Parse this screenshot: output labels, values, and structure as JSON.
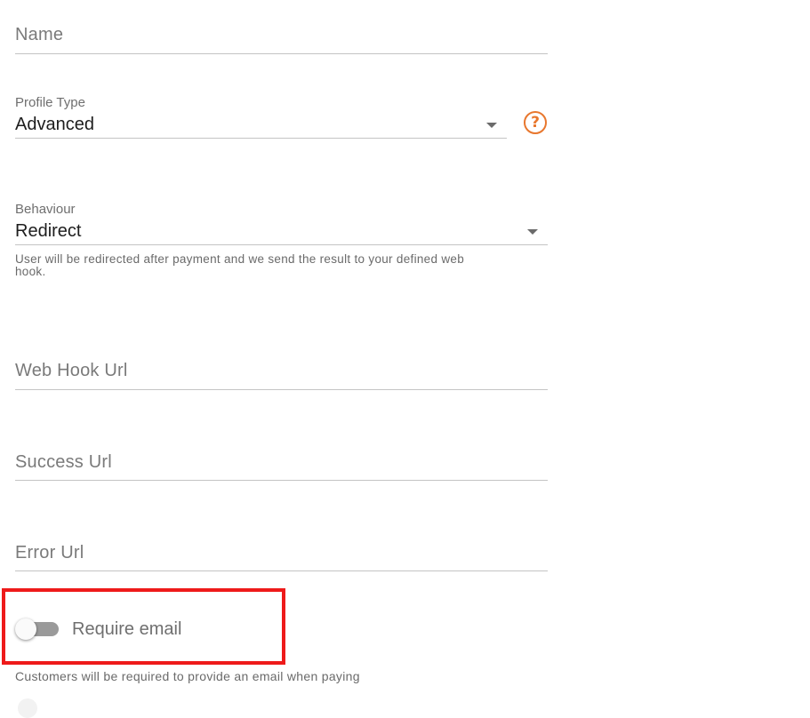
{
  "form": {
    "name_placeholder": "Name",
    "profile_type": {
      "label": "Profile Type",
      "value": "Advanced"
    },
    "behaviour": {
      "label": "Behaviour",
      "value": "Redirect",
      "hint_line1": "User will be redirected after payment and we send the result to your defined web",
      "hint_line2": "hook."
    },
    "web_hook_placeholder": "Web Hook Url",
    "success_placeholder": "Success Url",
    "error_placeholder": "Error Url",
    "require_email": {
      "label": "Require email",
      "checked": false,
      "hint": "Customers will be required to provide an email when paying"
    }
  },
  "help_icon_glyph": "?",
  "colors": {
    "accent": "#e8772e",
    "highlight": "#ee1a1a"
  }
}
